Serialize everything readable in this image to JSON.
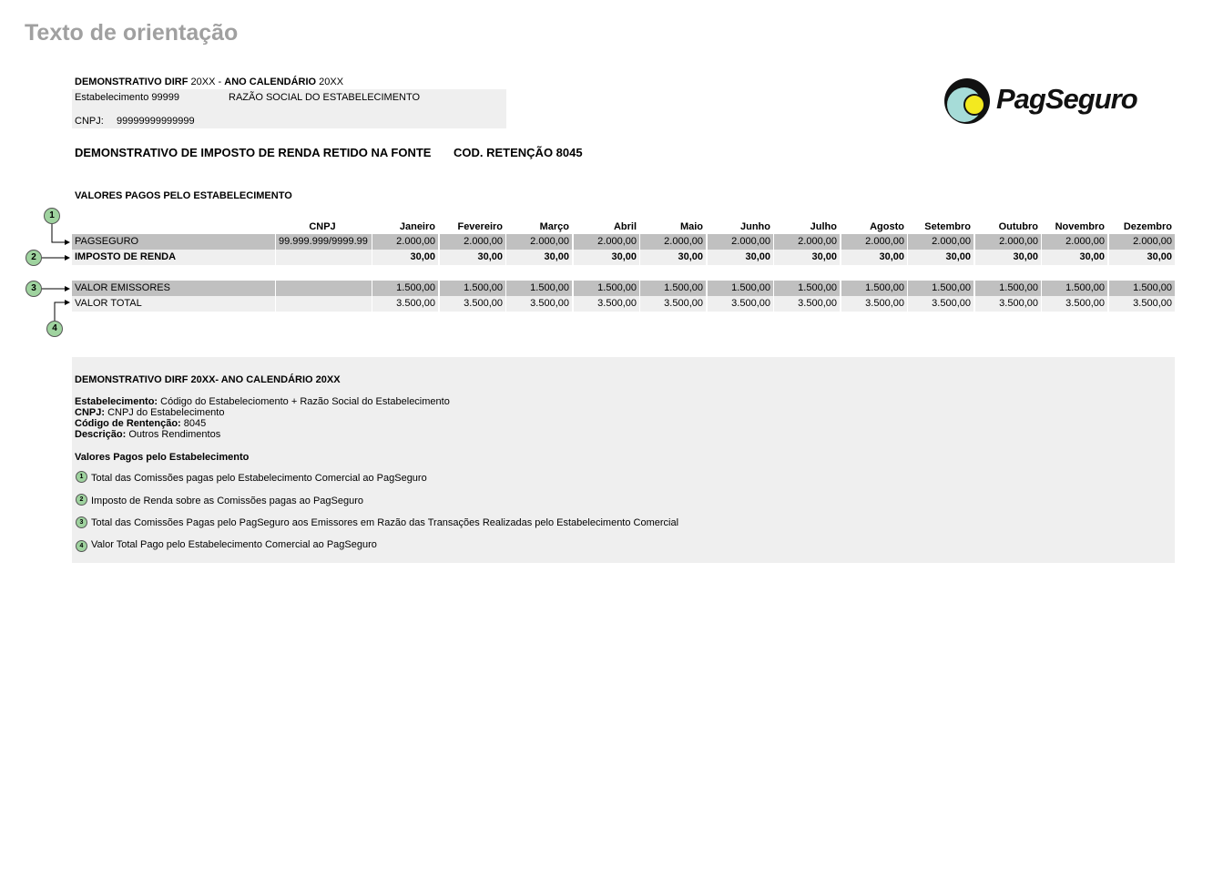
{
  "page_title": "Texto de orientação",
  "header": {
    "demonstrativo_label": "DEMONSTRATIVO DIRF",
    "year": "20XX",
    "separator": "-",
    "ano_label": "ANO CALENDÁRIO",
    "ano_year": "20XX",
    "estabelecimento": "Estabelecimento 99999",
    "razao_social": "RAZÃO SOCIAL DO ESTABELECIMENTO",
    "cnpj_label": "CNPJ:",
    "cnpj_value": "99999999999999"
  },
  "logo": {
    "name": "pagseguro-logo",
    "text": "PagSeguro"
  },
  "subtitle": "DEMONSTRATIVO DE IMPOSTO DE RENDA RETIDO NA FONTE",
  "retencao": "COD. RETENÇÃO 8045",
  "section_title": "VALORES PAGOS PELO ESTABELECIMENTO",
  "table": {
    "headers": [
      "CNPJ",
      "Janeiro",
      "Fevereiro",
      "Março",
      "Abril",
      "Maio",
      "Junho",
      "Julho",
      "Agosto",
      "Setembro",
      "Outubro",
      "Novembro",
      "Dezembro"
    ],
    "rows": [
      {
        "label": "PAGSEGURO",
        "cnpj": "99.999.999/9999.99",
        "values": [
          "2.000,00",
          "2.000,00",
          "2.000,00",
          "2.000,00",
          "2.000,00",
          "2.000,00",
          "2.000,00",
          "2.000,00",
          "2.000,00",
          "2.000,00",
          "2.000,00",
          "2.000,00"
        ]
      },
      {
        "label": "IMPOSTO DE RENDA",
        "cnpj": "",
        "values": [
          "30,00",
          "30,00",
          "30,00",
          "30,00",
          "30,00",
          "30,00",
          "30,00",
          "30,00",
          "30,00",
          "30,00",
          "30,00",
          "30,00"
        ]
      },
      {
        "label": "VALOR EMISSORES",
        "cnpj": "",
        "values": [
          "1.500,00",
          "1.500,00",
          "1.500,00",
          "1.500,00",
          "1.500,00",
          "1.500,00",
          "1.500,00",
          "1.500,00",
          "1.500,00",
          "1.500,00",
          "1.500,00",
          "1.500,00"
        ]
      },
      {
        "label": "VALOR TOTAL",
        "cnpj": "",
        "values": [
          "3.500,00",
          "3.500,00",
          "3.500,00",
          "3.500,00",
          "3.500,00",
          "3.500,00",
          "3.500,00",
          "3.500,00",
          "3.500,00",
          "3.500,00",
          "3.500,00",
          "3.500,00"
        ]
      }
    ]
  },
  "markers": [
    "1",
    "2",
    "3",
    "4"
  ],
  "legend": {
    "title": "DEMONSTRATIVO DIRF 20XX- ANO CALENDÁRIO 20XX",
    "estab_label": "Estabelecimento:",
    "estab_text": "Código do Estabeleciomento + Razão Social do Estabelecimento",
    "cnpj_label": "CNPJ:",
    "cnpj_text": "CNPJ do Estabelecimento",
    "codigo_label": "Código de Rentenção:",
    "codigo_text": "8045",
    "descricao_label": "Descrição:",
    "descricao_text": "Outros Rendimentos",
    "valores_title": "Valores Pagos pelo Estabelecimento",
    "items": [
      "Total das Comissões pagas pelo Estabelecimento Comercial ao PagSeguro",
      "Imposto de Renda sobre as Comissões pagas ao PagSeguro",
      "Total das Comissões Pagas pelo PagSeguro aos Emissores em Razão das Transações Realizadas pelo Estabelecimento Comercial",
      "Valor Total Pago pelo Estabelecimento Comercial ao PagSeguro"
    ]
  }
}
